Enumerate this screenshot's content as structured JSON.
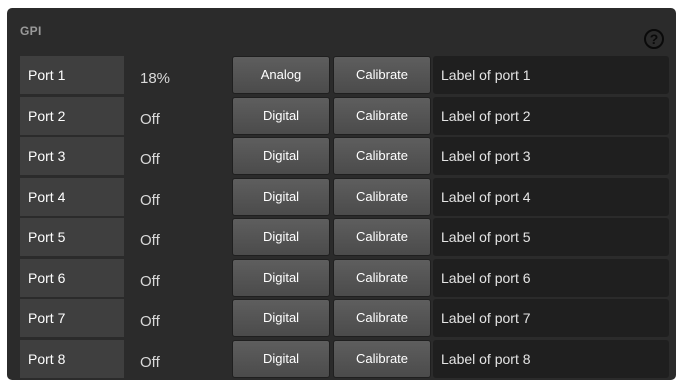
{
  "panel": {
    "title": "GPI",
    "help_icon": "?"
  },
  "ports": [
    {
      "name": "Port 1",
      "value": "18%",
      "mode": "Analog",
      "calibrate": "Calibrate",
      "label": "Label of port 1"
    },
    {
      "name": "Port 2",
      "value": "Off",
      "mode": "Digital",
      "calibrate": "Calibrate",
      "label": "Label of port 2"
    },
    {
      "name": "Port 3",
      "value": "Off",
      "mode": "Digital",
      "calibrate": "Calibrate",
      "label": "Label of port 3"
    },
    {
      "name": "Port 4",
      "value": "Off",
      "mode": "Digital",
      "calibrate": "Calibrate",
      "label": "Label of port 4"
    },
    {
      "name": "Port 5",
      "value": "Off",
      "mode": "Digital",
      "calibrate": "Calibrate",
      "label": "Label of port 5"
    },
    {
      "name": "Port 6",
      "value": "Off",
      "mode": "Digital",
      "calibrate": "Calibrate",
      "label": "Label of port 6"
    },
    {
      "name": "Port 7",
      "value": "Off",
      "mode": "Digital",
      "calibrate": "Calibrate",
      "label": "Label of port 7"
    },
    {
      "name": "Port 8",
      "value": "Off",
      "mode": "Digital",
      "calibrate": "Calibrate",
      "label": "Label of port 8"
    }
  ],
  "colors": {
    "panel_bg": "#2b2b2b",
    "port_name_bg": "#3f3f3f",
    "label_field_bg": "#1f1f1f",
    "button_bg": "#555555"
  },
  "icons": {
    "help": "question-circle-icon"
  }
}
